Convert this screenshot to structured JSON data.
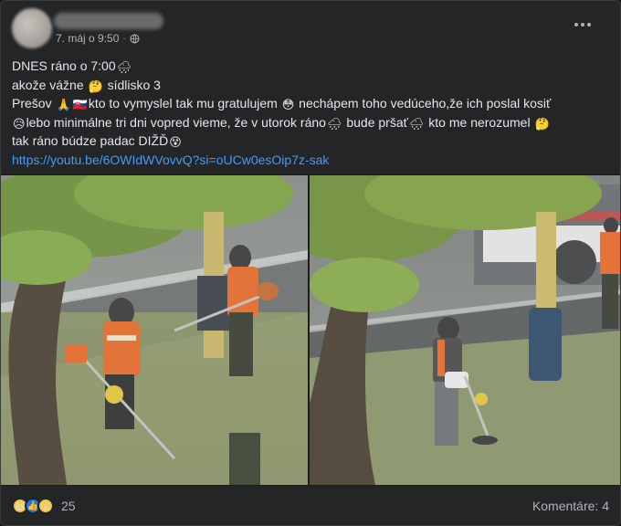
{
  "post": {
    "timestamp": "7. máj o 9:50",
    "separator": "·",
    "lines": {
      "l1_a": "DNES ráno o 7:00",
      "l2_a": "akože vážne",
      "l2_b": "sídlisko 3",
      "l3_a": "Prešov",
      "l3_b": "kto to vymyslel tak mu gratulujem",
      "l3_c": "nechápem toho vedúceho,že ich poslal kosiť",
      "l4_a": "lebo minimálne tri dni vopred vieme, že v utorok ráno",
      "l4_b": "bude pršať",
      "l4_c": "kto me nerozumel",
      "l5_a": "tak ráno búdze padac DIŽĎ",
      "link": "https://youtu.be/6OWIdWVovvQ?si=oUCw0esOip7z-sak"
    },
    "emoji": {
      "rain": "🌧",
      "thinking": "🤔",
      "pray": "🙏",
      "flag": "🇸🇰",
      "flushed": "😳",
      "sad": "😥",
      "sleepy": "😵"
    }
  },
  "reactions": {
    "icons": [
      "haha-icon",
      "like-icon",
      "wow-icon"
    ],
    "count": "25"
  },
  "comments_label": "Komentáre: 4"
}
